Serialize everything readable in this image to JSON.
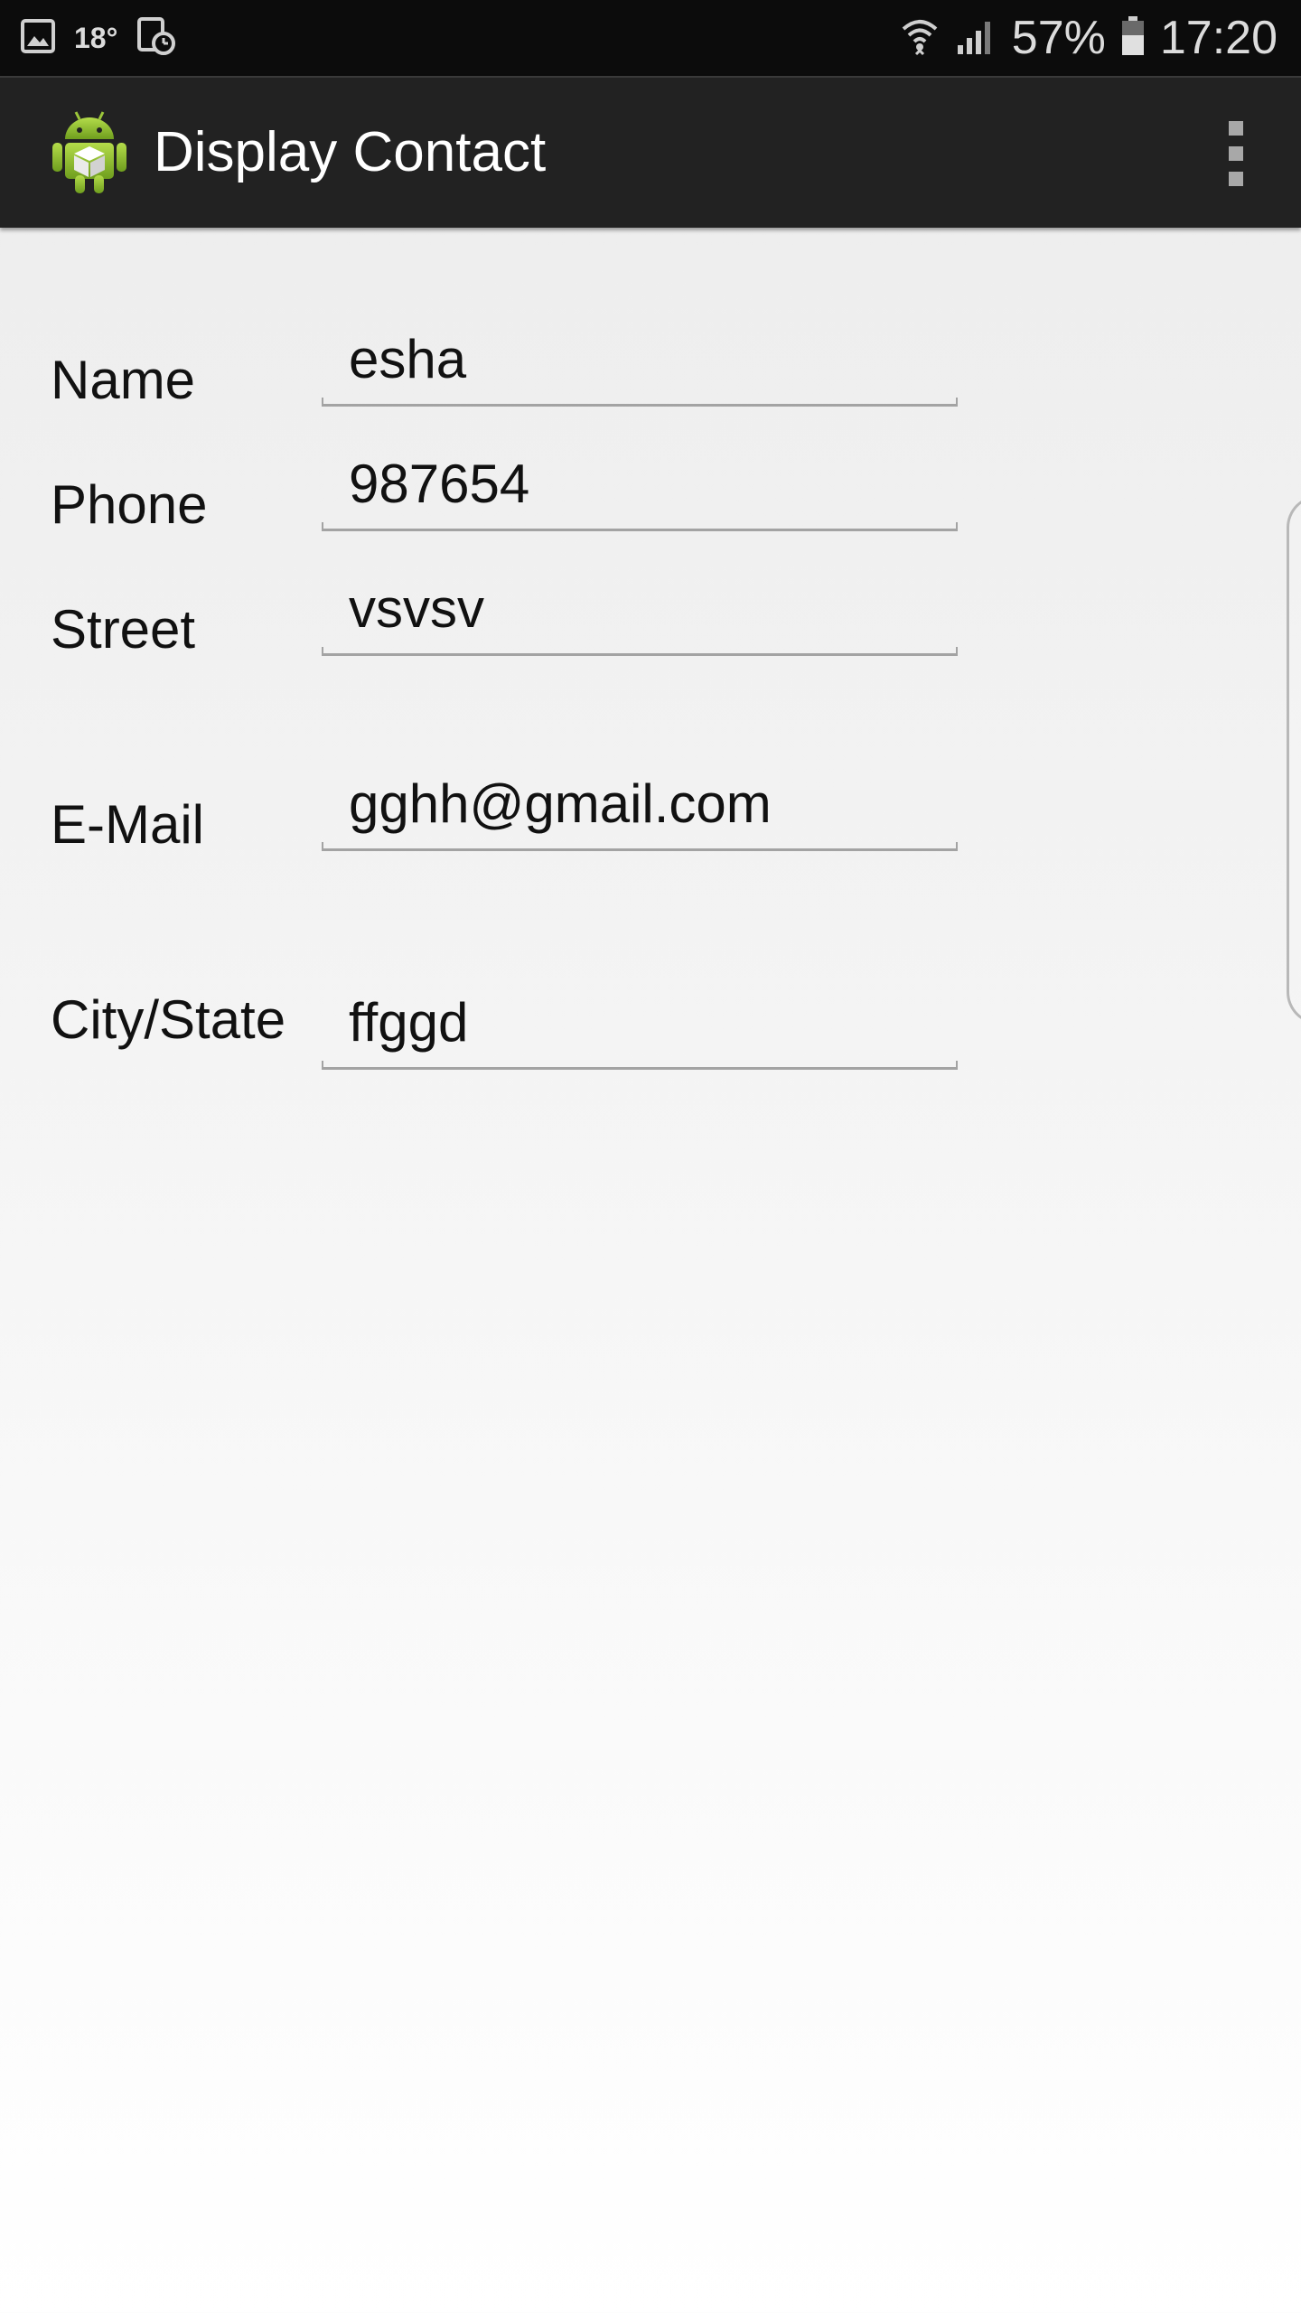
{
  "status_bar": {
    "temperature": "18°",
    "battery_percent": "57%",
    "time": "17:20",
    "icons": [
      "gallery-icon",
      "clock-icon",
      "wifi-icon",
      "signal-icon",
      "battery-icon"
    ]
  },
  "action_bar": {
    "title": "Display Contact",
    "app_icon": "android-icon",
    "menu_icon": "overflow-menu-icon"
  },
  "form": {
    "name": {
      "label": "Name",
      "value": "esha"
    },
    "phone": {
      "label": "Phone",
      "value": "987654"
    },
    "street": {
      "label": "Street",
      "value": "vsvsv"
    },
    "email": {
      "label": "E-Mail",
      "value": "gghh@gmail.com"
    },
    "city_state": {
      "label": "City/State",
      "value": "ffggd"
    }
  },
  "colors": {
    "action_bar_bg": "#222222",
    "status_bar_bg": "#0c0c0c",
    "android_green": "#8ab92b",
    "field_underline": "#a3a3a3"
  }
}
